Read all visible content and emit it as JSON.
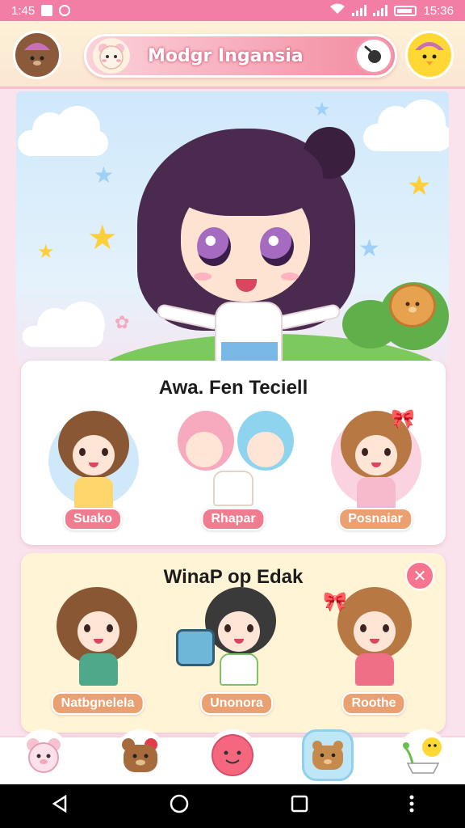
{
  "status_bar": {
    "time": "1:45",
    "clock": "15:36"
  },
  "header": {
    "title": "Modgr Ingansia",
    "left_avatar_icon": "bear-with-pink-hat-icon",
    "right_avatar_icon": "yellow-chick-icon",
    "pill_icon": "pink-bear-icon",
    "action_icon": "frying-pan-icon"
  },
  "hero": {
    "mascot": "chibi-girl-purple-hair",
    "accent": "#f27ea6"
  },
  "card1": {
    "title": "Awa. Fen Teciell",
    "characters": [
      {
        "name": "Suako",
        "color": "#ef7d8f"
      },
      {
        "name": "Rhapar",
        "color": "#ef7d8f"
      },
      {
        "name": "Posnaiar",
        "color": "#eaa070"
      }
    ]
  },
  "card2": {
    "title": "WinaP op Edak",
    "close_icon": "close-icon",
    "characters": [
      {
        "name": "Natbgnelela",
        "color": "#eaa070"
      },
      {
        "name": "Unonora",
        "color": "#eaa070"
      },
      {
        "name": "Roothe",
        "color": "#eaa070"
      }
    ]
  },
  "bottom_nav": {
    "items": [
      "pink-bear-icon",
      "brown-bear-icon",
      "smiley-ball-icon",
      "bear-active-icon",
      "chick-plant-icon"
    ]
  }
}
